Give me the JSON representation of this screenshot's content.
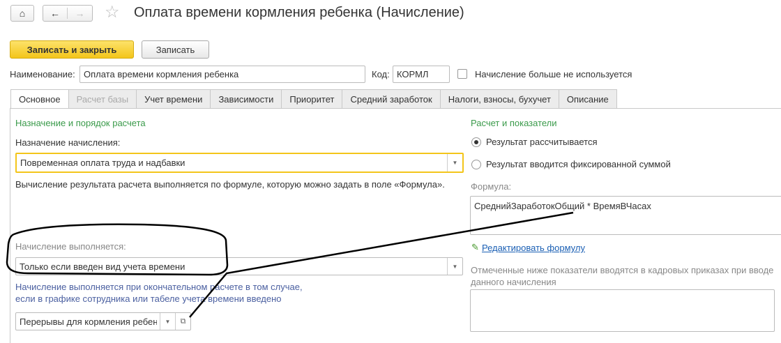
{
  "header": {
    "title": "Оплата времени кормления ребенка (Начисление)",
    "home_icon": "home-icon",
    "back_icon": "arrow-left-icon",
    "forward_icon": "arrow-right-icon",
    "favorite_icon": "star-icon"
  },
  "toolbar": {
    "save_close": "Записать и закрыть",
    "save": "Записать",
    "accent": "#f3c51a"
  },
  "fields": {
    "name_label": "Наименование:",
    "name_value": "Оплата времени кормления ребенка",
    "code_label": "Код:",
    "code_value": "КОРМЛ",
    "unused_label": "Начисление больше не используется",
    "unused_checked": false
  },
  "tabs": [
    {
      "label": "Основное"
    },
    {
      "label": "Расчет базы"
    },
    {
      "label": "Учет времени"
    },
    {
      "label": "Зависимости"
    },
    {
      "label": "Приоритет"
    },
    {
      "label": "Средний заработок"
    },
    {
      "label": "Налоги, взносы, бухучет"
    },
    {
      "label": "Описание"
    }
  ],
  "left": {
    "section": "Назначение и порядок расчета",
    "purpose_label": "Назначение начисления:",
    "purpose_value": "Повременная оплата труда и надбавки",
    "formula_note": "Вычисление результата расчета выполняется по формуле, которую можно задать в поле «Формула».",
    "exec_label": "Начисление выполняется:",
    "exec_value": "Только если введен вид учета времени",
    "exec_note1": "Начисление выполняется при окончательном расчете в том случае,",
    "exec_note2": "если в графике сотрудника или табеле учета времени введено",
    "time_type_value": "Перерывы для кормления ребенк"
  },
  "right": {
    "section": "Расчет и показатели",
    "radio1": "Результат рассчитывается",
    "radio2": "Результат вводится фиксированной суммой",
    "selected": "radio1",
    "formula_label": "Формула:",
    "formula_value": "СреднийЗаработокОбщий * ВремяВЧасах",
    "edit_link": "Редактировать формулу",
    "indicators_note1": "Отмеченные ниже показатели вводятся в кадровых приказах при вводе",
    "indicators_note2": "данного начисления"
  }
}
